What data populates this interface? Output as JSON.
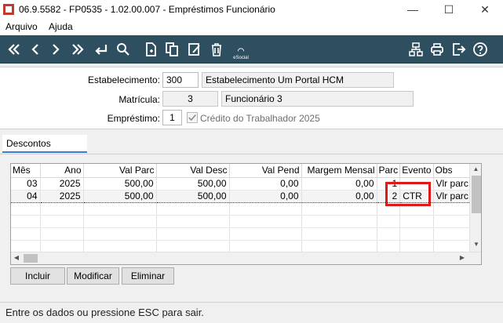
{
  "window": {
    "title": "06.9.5582 - FP0535 - 1.02.00.007 - Empréstimos Funcionário",
    "app_icon": "app-icon"
  },
  "menu": {
    "items": [
      "Arquivo",
      "Ajuda"
    ]
  },
  "toolbar": {
    "esocial_label": "eSocial",
    "icons": [
      "first-icon",
      "previous-icon",
      "next-icon",
      "last-icon",
      "return-icon",
      "search-icon",
      "new-icon",
      "copy-icon",
      "edit-icon",
      "delete-icon",
      "esocial-icon",
      "structure-icon",
      "print-icon",
      "exit-icon",
      "help-icon"
    ]
  },
  "form": {
    "estabelecimento_label": "Estabelecimento:",
    "estabelecimento_code": "300",
    "estabelecimento_desc": "Estabelecimento Um Portal HCM",
    "matricula_label": "Matrícula:",
    "matricula_code": "3",
    "matricula_desc": "Funcionário 3",
    "emprestimo_label": "Empréstimo:",
    "emprestimo_code": "1",
    "emprestimo_checkbox_label": "Crédito do Trabalhador 2025",
    "emprestimo_checked": true
  },
  "tabs": [
    {
      "label": "Descontos",
      "active": true
    }
  ],
  "grid": {
    "columns": [
      "Mês",
      "Ano",
      "Val Parc",
      "Val Desc",
      "Val Pend",
      "Margem Mensal",
      "Parc",
      "Evento",
      "Obs"
    ],
    "rows": [
      {
        "mes": "03",
        "ano": "2025",
        "val_parc": "500,00",
        "val_desc": "500,00",
        "val_pend": "0,00",
        "margem": "0,00",
        "parc": "1",
        "evento": "",
        "obs": "Vlr parc",
        "selected": false
      },
      {
        "mes": "04",
        "ano": "2025",
        "val_parc": "500,00",
        "val_desc": "500,00",
        "val_pend": "0,00",
        "margem": "0,00",
        "parc": "2",
        "evento": "CTR",
        "obs": "Vlr parc",
        "selected": true
      }
    ],
    "empty_rows": 4
  },
  "buttons": {
    "incluir": "Incluir",
    "modificar": "Modificar",
    "eliminar": "Eliminar"
  },
  "status": {
    "text": "Entre os dados ou pressione ESC para sair."
  },
  "colors": {
    "toolbar_bg": "#2e4f5f",
    "highlight": "#e01818",
    "tab_accent": "#3a7bd5"
  }
}
